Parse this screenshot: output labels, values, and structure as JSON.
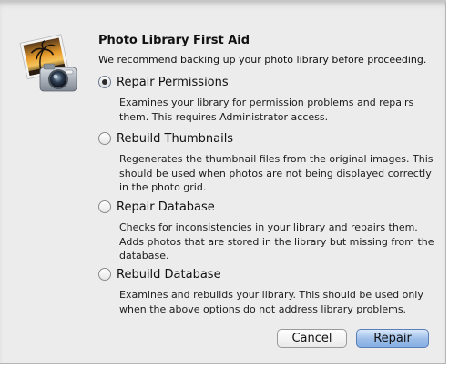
{
  "dialog": {
    "title": "Photo Library First Aid",
    "subtitle": "We recommend backing up your photo library before proceeding.",
    "icon": "iphoto-camera-icon"
  },
  "options": [
    {
      "label": "Repair Permissions",
      "selected": true,
      "description": [
        "Examines your library for permission problems and repairs",
        "them. This requires Administrator access."
      ]
    },
    {
      "label": "Rebuild Thumbnails",
      "selected": false,
      "description": [
        "Regenerates the thumbnail files from the original images. This",
        "should be used when photos are not being displayed correctly",
        "in the photo grid."
      ]
    },
    {
      "label": "Repair Database",
      "selected": false,
      "description": [
        "Checks for inconsistencies in your library and repairs them.",
        "Adds photos that are stored in the library but missing from the",
        "database."
      ]
    },
    {
      "label": "Rebuild Database",
      "selected": false,
      "description": [
        "Examines and rebuilds your library. This should be used only",
        "when the above options do not address library problems."
      ]
    }
  ],
  "buttons": {
    "cancel": "Cancel",
    "repair": "Repair"
  },
  "colors": {
    "sheet_background": "#ececec",
    "default_button": "#9bbde8"
  }
}
